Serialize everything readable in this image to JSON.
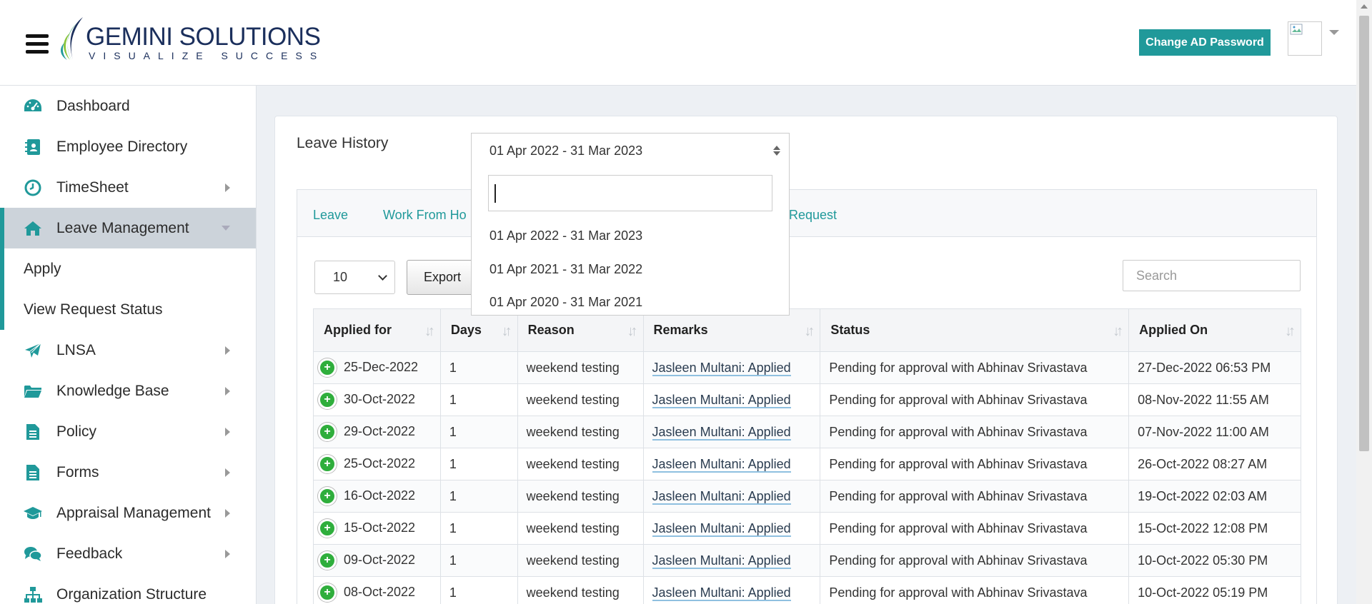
{
  "header": {
    "logo_main": "GEMINI SOLUTIONS",
    "logo_tagline": "VISUALIZE SUCCESS",
    "change_password_label": "Change AD Password"
  },
  "sidebar": {
    "items": [
      {
        "label": "Dashboard",
        "icon": "dashboard-icon"
      },
      {
        "label": "Employee Directory",
        "icon": "contact-book-icon"
      },
      {
        "label": "TimeSheet",
        "icon": "clock-icon"
      },
      {
        "label": "Leave Management",
        "icon": "home-icon"
      },
      {
        "label": "LNSA",
        "icon": "paper-plane-icon"
      },
      {
        "label": "Knowledge Base",
        "icon": "folder-icon"
      },
      {
        "label": "Policy",
        "icon": "document-icon"
      },
      {
        "label": "Forms",
        "icon": "document-icon"
      },
      {
        "label": "Appraisal Management",
        "icon": "graduation-cap-icon"
      },
      {
        "label": "Feedback",
        "icon": "comments-icon"
      },
      {
        "label": "Organization Structure",
        "icon": "sitemap-icon"
      }
    ],
    "sub_items": [
      "Apply",
      "View Request Status"
    ]
  },
  "main": {
    "title": "Leave History",
    "tabs": [
      "Leave",
      "Work From Ho",
      "Request"
    ],
    "page_length": "10",
    "export_label": "Export",
    "search_placeholder": "Search"
  },
  "dropdown": {
    "selected": "01 Apr 2022 - 31 Mar 2023",
    "options": [
      "01 Apr 2022 - 31 Mar 2023",
      "01 Apr 2021 - 31 Mar 2022",
      "01 Apr 2020 - 31 Mar 2021"
    ]
  },
  "table": {
    "headers": [
      "Applied for",
      "Days",
      "Reason",
      "Remarks",
      "Status",
      "Applied On"
    ],
    "rows": [
      [
        "25-Dec-2022",
        "1",
        "weekend testing",
        "Jasleen Multani: Applied",
        "Pending for approval with Abhinav Srivastava",
        "27-Dec-2022 06:53 PM"
      ],
      [
        "30-Oct-2022",
        "1",
        "weekend testing",
        "Jasleen Multani: Applied",
        "Pending for approval with Abhinav Srivastava",
        "08-Nov-2022 11:55 AM"
      ],
      [
        "29-Oct-2022",
        "1",
        "weekend testing",
        "Jasleen Multani: Applied",
        "Pending for approval with Abhinav Srivastava",
        "07-Nov-2022 11:00 AM"
      ],
      [
        "25-Oct-2022",
        "1",
        "weekend testing",
        "Jasleen Multani: Applied",
        "Pending for approval with Abhinav Srivastava",
        "26-Oct-2022 08:27 AM"
      ],
      [
        "16-Oct-2022",
        "1",
        "weekend testing",
        "Jasleen Multani: Applied",
        "Pending for approval with Abhinav Srivastava",
        "19-Oct-2022 02:03 AM"
      ],
      [
        "15-Oct-2022",
        "1",
        "weekend testing",
        "Jasleen Multani: Applied",
        "Pending for approval with Abhinav Srivastava",
        "15-Oct-2022 12:08 PM"
      ],
      [
        "09-Oct-2022",
        "1",
        "weekend testing",
        "Jasleen Multani: Applied",
        "Pending for approval with Abhinav Srivastava",
        "10-Oct-2022 05:30 PM"
      ],
      [
        "08-Oct-2022",
        "1",
        "weekend testing",
        "Jasleen Multani: Applied",
        "Pending for approval with Abhinav Srivastava",
        "10-Oct-2022 05:19 PM"
      ]
    ]
  },
  "colors": {
    "accent": "#20999a",
    "plus_green": "#2fae3c"
  }
}
